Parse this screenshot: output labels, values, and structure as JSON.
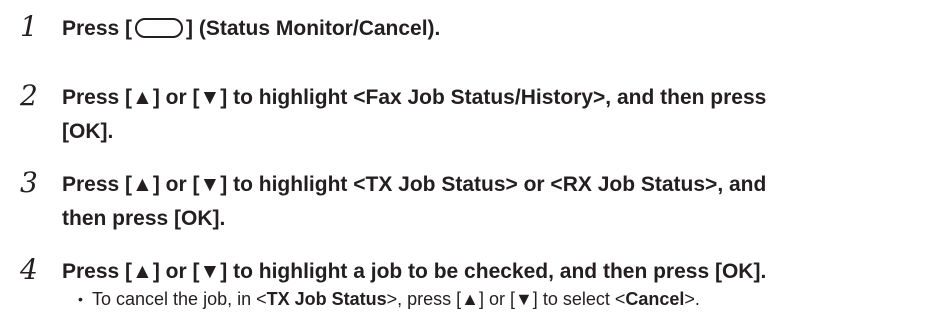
{
  "steps": [
    {
      "number": "1",
      "text_before": "Press [",
      "text_after": "] (Status Monitor/Cancel)."
    },
    {
      "number": "2",
      "line1": "Press [▲] or [▼] to highlight <Fax Job Status/History>, and then press",
      "line2": "[OK]."
    },
    {
      "number": "3",
      "line1": "Press [▲] or [▼] to highlight <TX Job Status> or <RX Job Status>, and",
      "line2": "then press [OK]."
    },
    {
      "number": "4",
      "line1": "Press [▲] or [▼] to highlight a job to be checked, and then press [OK].",
      "note": {
        "bullet": "•",
        "part1": "To cancel the job, in <",
        "bold1": "TX Job Status",
        "part2": ">, press [▲] or [▼] to select <",
        "bold2": "Cancel",
        "part3": ">."
      }
    }
  ]
}
